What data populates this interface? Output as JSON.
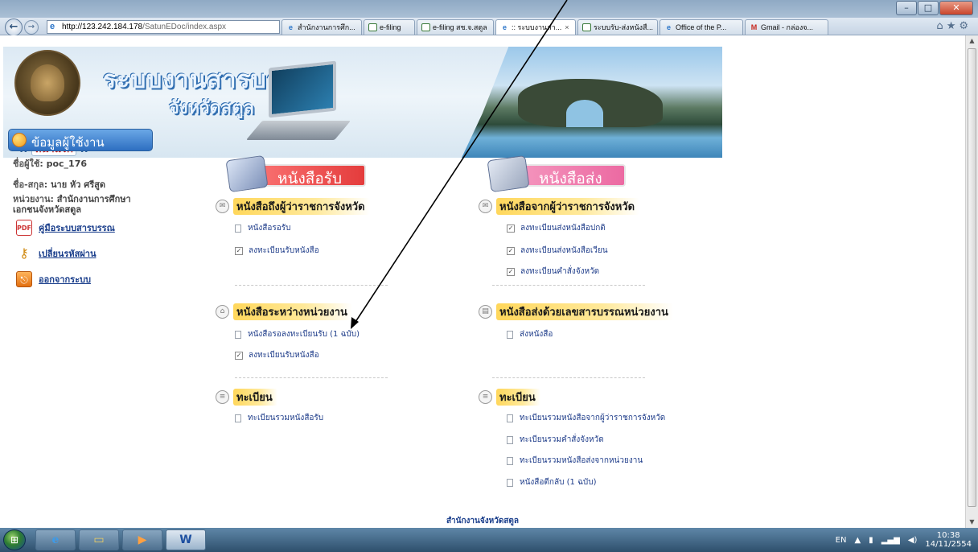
{
  "browser": {
    "address_host": "http://123.242.184.178",
    "address_path": "/SatunEDoc/index.aspx",
    "tabs": [
      {
        "label": "สำนักงานการศึก...",
        "icon": "ie-icon",
        "active": false
      },
      {
        "label": "e-filing",
        "icon": "mail-icon",
        "active": false
      },
      {
        "label": "e-filing สช.จ.สตูล",
        "icon": "mail-icon",
        "active": false
      },
      {
        "label": ":: ระบบงานสา...",
        "icon": "ie-icon",
        "active": true
      },
      {
        "label": "ระบบรับ-ส่งหนังสื...",
        "icon": "mail-icon",
        "active": false
      },
      {
        "label": "Office of the P...",
        "icon": "ie-icon",
        "active": false
      },
      {
        "label": "Gmail - กล่องจ...",
        "icon": "gmail-icon",
        "active": false
      }
    ]
  },
  "banner": {
    "title_line1": "ระบบงานสารบรรณ",
    "title_line2": "จังหวัดสตูล",
    "home_prefix": "::",
    "home_label": "หน้าแรก",
    "home_suffix": "::"
  },
  "sidebar": {
    "header": "ข้อมูลผู้ใช้งาน",
    "username_label": "ชื่อผู้ใช้:",
    "username": "poc_176",
    "fullname_label": "ชื่อ-สกุล:",
    "fullname": "นาย หัว ศรีสูด",
    "agency_label": "หน่วยงาน:",
    "agency_line1": "สำนักงานการศึกษา",
    "agency_line2": "เอกชนจังหวัดสตูล",
    "links": [
      {
        "label": "คู่มือระบบสารบรรณ",
        "icon": "pdf-icon"
      },
      {
        "label": "เปลี่ยนรหัสผ่าน",
        "icon": "key-icon"
      },
      {
        "label": "ออกจากระบบ",
        "icon": "logout-icon"
      }
    ]
  },
  "receive": {
    "banner_label": "หนังสือรับ",
    "sections": [
      {
        "heading": "หนังสือถึงผู้ว่าราชการจังหวัด",
        "items": [
          {
            "label": "หนังสือรอรับ",
            "type": "doc"
          },
          {
            "label": "ลงทะเบียนรับหนังสือ",
            "type": "check"
          }
        ]
      },
      {
        "heading": "หนังสือระหว่างหน่วยงาน",
        "items": [
          {
            "label": "หนังสือรอลงทะเบียนรับ (1 ฉบับ)",
            "type": "doc"
          },
          {
            "label": "ลงทะเบียนรับหนังสือ",
            "type": "check"
          }
        ]
      },
      {
        "heading": "ทะเบียน",
        "items": [
          {
            "label": "ทะเบียนรวมหนังสือรับ",
            "type": "doc"
          }
        ]
      }
    ]
  },
  "send": {
    "banner_label": "หนังสือส่ง",
    "sections": [
      {
        "heading": "หนังสือจากผู้ว่าราชการจังหวัด",
        "items": [
          {
            "label": "ลงทะเบียนส่งหนังสือปกติ",
            "type": "check"
          },
          {
            "label": "ลงทะเบียนส่งหนังสือเวียน",
            "type": "check"
          },
          {
            "label": "ลงทะเบียนคำสั่งจังหวัด",
            "type": "check"
          }
        ]
      },
      {
        "heading": "หนังสือส่งด้วยเลขสารบรรณหน่วยงาน",
        "items": [
          {
            "label": "ส่งหนังสือ",
            "type": "doc"
          }
        ]
      },
      {
        "heading": "ทะเบียน",
        "items": [
          {
            "label": "ทะเบียนรวมหนังสือจากผู้ว่าราชการจังหวัด",
            "type": "doc"
          },
          {
            "label": "ทะเบียนรวมคำสั่งจังหวัด",
            "type": "doc"
          },
          {
            "label": "ทะเบียนรวมหนังสือส่งจากหน่วยงาน",
            "type": "doc"
          },
          {
            "label": "หนังสือตีกลับ (1 ฉบับ)",
            "type": "doc"
          }
        ]
      }
    ]
  },
  "footer": "สำนักงานจังหวัดสตูล",
  "taskbar": {
    "lang": "EN",
    "time": "10:38",
    "date": "14/11/2554"
  }
}
